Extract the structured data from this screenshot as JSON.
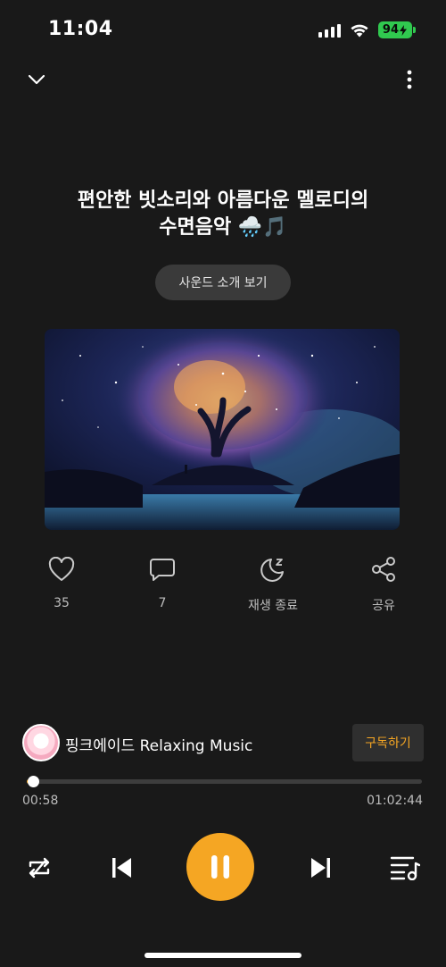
{
  "status": {
    "time": "11:04",
    "battery": "94"
  },
  "header": {
    "collapse_icon": "chevron-down-icon",
    "more_icon": "more-vertical-icon"
  },
  "track": {
    "title_line1": "편안한 빗소리와 아름다운 멜로디의",
    "title_line2": "수면음악 🌧️🎵",
    "intro_label": "사운드 소개 보기"
  },
  "actions": {
    "likes": "35",
    "comments": "7",
    "sleep_timer": "재생 종료",
    "share": "공유"
  },
  "channel": {
    "name": "핑크에이드 Relaxing Music",
    "subscribe_label": "구독하기"
  },
  "player": {
    "current_time": "00:58",
    "total_time": "01:02:44",
    "progress": 0.015,
    "accent_color": "#f5a623"
  }
}
